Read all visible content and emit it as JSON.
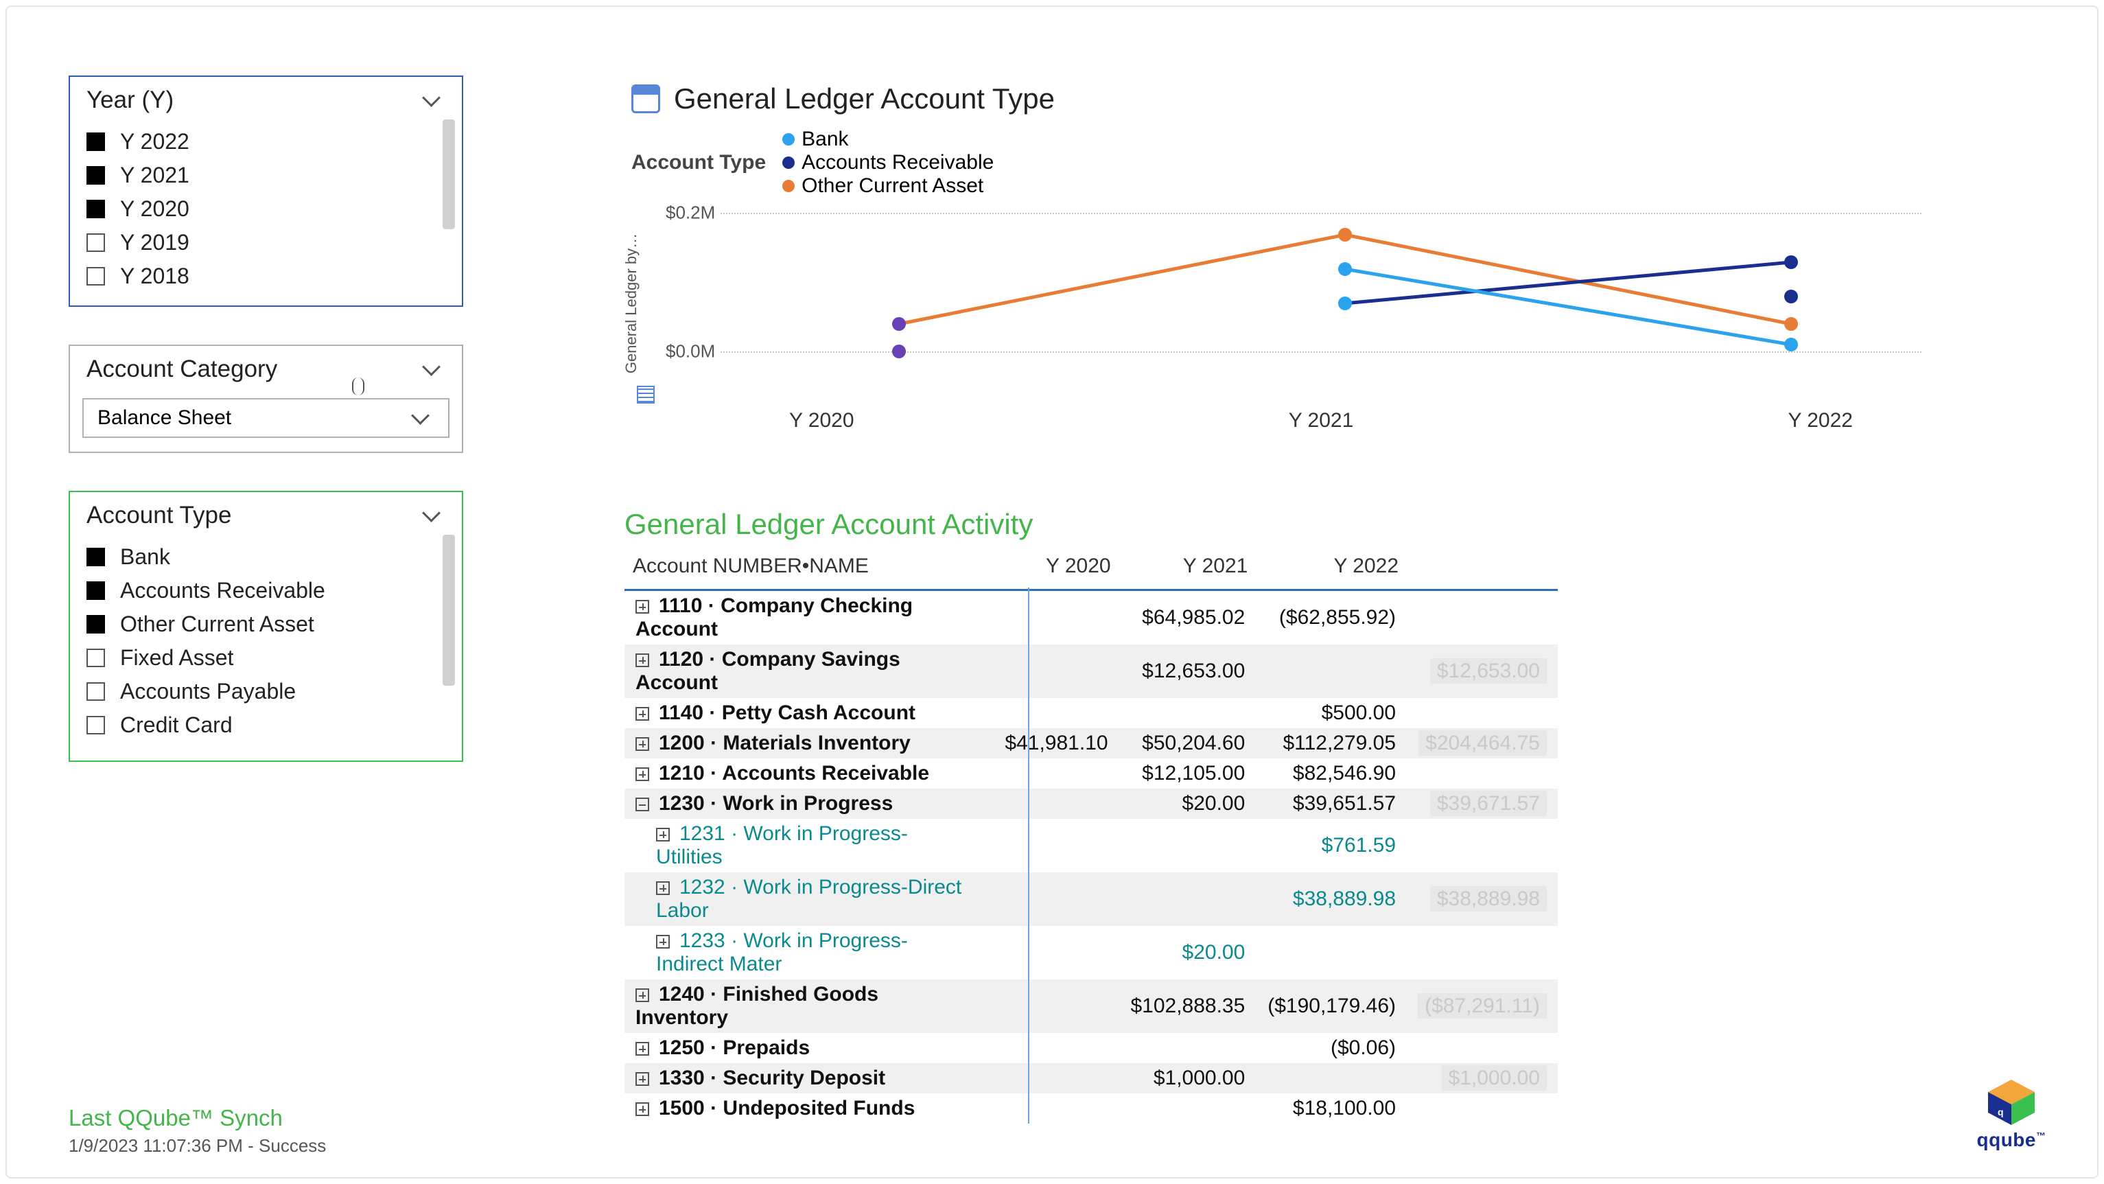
{
  "slicers": {
    "year": {
      "title": "Year (Y)",
      "items": [
        {
          "label": "Y 2022",
          "checked": true
        },
        {
          "label": "Y 2021",
          "checked": true
        },
        {
          "label": "Y 2020",
          "checked": true
        },
        {
          "label": "Y 2019",
          "checked": false
        },
        {
          "label": "Y 2018",
          "checked": false
        }
      ]
    },
    "category": {
      "title": "Account Category",
      "selected": "Balance Sheet"
    },
    "accountType": {
      "title": "Account Type",
      "items": [
        {
          "label": "Bank",
          "checked": true
        },
        {
          "label": "Accounts Receivable",
          "checked": true
        },
        {
          "label": "Other Current Asset",
          "checked": true
        },
        {
          "label": "Fixed Asset",
          "checked": false
        },
        {
          "label": "Accounts Payable",
          "checked": false
        },
        {
          "label": "Credit Card",
          "checked": false
        }
      ]
    }
  },
  "chart": {
    "title": "General Ledger Account Type",
    "legendTitle": "Account Type",
    "legend": [
      {
        "name": "Bank",
        "color": "#2aa3ec"
      },
      {
        "name": "Accounts Receivable",
        "color": "#1a2e8f"
      },
      {
        "name": "Other Current Asset",
        "color": "#e97c35"
      }
    ],
    "yAxisLabel": "General Ledger by…",
    "yTicks": [
      "$0.2M",
      "$0.0M"
    ]
  },
  "chart_data": {
    "type": "line",
    "categories": [
      "Y 2020",
      "Y 2021",
      "Y 2022"
    ],
    "series": [
      {
        "name": "Bank",
        "color": "#2aa3ec",
        "values": [
          null,
          0.12,
          0.01
        ]
      },
      {
        "name": "Bank (series 2)",
        "color": "#2aa3ec",
        "values": [
          null,
          0.07,
          null
        ]
      },
      {
        "name": "Accounts Receivable",
        "color": "#1a2e8f",
        "values": [
          null,
          0.07,
          0.13
        ]
      },
      {
        "name": "Accounts Receivable (series 2)",
        "color": "#6a3fb5",
        "values": [
          0.04,
          null,
          null
        ]
      },
      {
        "name": "Accounts Receivable (series 3)",
        "color": "#6a3fb5",
        "values": [
          0.0,
          null,
          null
        ]
      },
      {
        "name": "Other Current Asset",
        "color": "#e97c35",
        "values": [
          0.04,
          0.17,
          0.04
        ]
      },
      {
        "name": "Other Current Asset (series 2)",
        "color": "#1a2e8f",
        "values": [
          null,
          null,
          0.08
        ]
      }
    ],
    "xlabel": "",
    "ylabel": "General Ledger by…",
    "ylim": [
      0.0,
      0.2
    ],
    "yticks": [
      0.0,
      0.2
    ],
    "ytick_labels": [
      "$0.0M",
      "$0.2M"
    ]
  },
  "table": {
    "title": "General Ledger Account Activity",
    "columns": [
      "Account NUMBER•NAME",
      "Y 2020",
      "Y 2021",
      "Y 2022"
    ],
    "rows": [
      {
        "icon": "plus",
        "name": "1110 · Company Checking Account",
        "v": [
          "",
          "$64,985.02",
          "($62,855.92)"
        ],
        "ghost": ""
      },
      {
        "icon": "plus",
        "name": "1120 · Company Savings Account",
        "v": [
          "",
          "$12,653.00",
          ""
        ],
        "ghost": "$12,653.00",
        "stripe": true
      },
      {
        "icon": "plus",
        "name": "1140 · Petty Cash Account",
        "v": [
          "",
          "",
          "$500.00"
        ],
        "ghost": ""
      },
      {
        "icon": "plus",
        "name": "1200 · Materials Inventory",
        "v": [
          "$41,981.10",
          "$50,204.60",
          "$112,279.05"
        ],
        "ghost": "$204,464.75",
        "stripe": true
      },
      {
        "icon": "plus",
        "name": "1210 · Accounts Receivable",
        "v": [
          "",
          "$12,105.00",
          "$82,546.90"
        ],
        "ghost": ""
      },
      {
        "icon": "minus",
        "name": "1230 · Work in Progress",
        "v": [
          "",
          "$20.00",
          "$39,651.57"
        ],
        "ghost": "$39,671.57",
        "stripe": true
      },
      {
        "icon": "plus",
        "child": true,
        "name": "1231 · Work in Progress-Utilities",
        "v": [
          "",
          "",
          "$761.59"
        ],
        "ghost": ""
      },
      {
        "icon": "plus",
        "child": true,
        "name": "1232 · Work in Progress-Direct Labor",
        "v": [
          "",
          "",
          "$38,889.98"
        ],
        "ghost": "$38,889.98",
        "stripe": true
      },
      {
        "icon": "plus",
        "child": true,
        "name": "1233 · Work in Progress-Indirect Mater",
        "v": [
          "",
          "$20.00",
          ""
        ],
        "ghost": ""
      },
      {
        "icon": "plus",
        "name": "1240 · Finished Goods Inventory",
        "v": [
          "",
          "$102,888.35",
          "($190,179.46)"
        ],
        "ghost": "($87,291.11)",
        "stripe": true
      },
      {
        "icon": "plus",
        "name": "1250 · Prepaids",
        "v": [
          "",
          "",
          "($0.06)"
        ],
        "ghost": ""
      },
      {
        "icon": "plus",
        "name": "1330 · Security Deposit",
        "v": [
          "",
          "$1,000.00",
          ""
        ],
        "ghost": "$1,000.00",
        "stripe": true
      },
      {
        "icon": "plus",
        "name": "1500 · Undeposited Funds",
        "v": [
          "",
          "",
          "$18,100.00"
        ],
        "ghost": ""
      }
    ]
  },
  "footer": {
    "label": "Last QQube™ Synch",
    "timestamp": "1/9/2023 11:07:36 PM - Success"
  },
  "logo": {
    "text": "qqube",
    "tm": "™"
  },
  "colors": {
    "green": "#44b54b",
    "blue": "#2d6fb6"
  }
}
